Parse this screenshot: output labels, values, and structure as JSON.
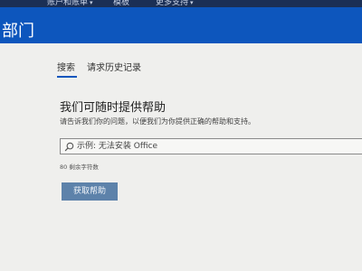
{
  "nav": {
    "item1": "账户和账单",
    "item2": "模板",
    "item3": "更多支持"
  },
  "banner": {
    "title": "部门"
  },
  "tabs": [
    {
      "label": "搜索",
      "active": true
    },
    {
      "label": "请求历史记录",
      "active": false
    }
  ],
  "main": {
    "heading": "我们可随时提供帮助",
    "subtext": "请告诉我们你的问题，以便我们为你提供正确的帮助和支持。",
    "search": {
      "placeholder": "示例: 无法安装 Office",
      "value": ""
    },
    "char_count": "80 剩余字符数",
    "help_button_label": "获取帮助"
  },
  "colors": {
    "banner": "#0d56bd",
    "topbar": "#1b2f55",
    "button": "#5d82aa",
    "background": "#efefed"
  }
}
